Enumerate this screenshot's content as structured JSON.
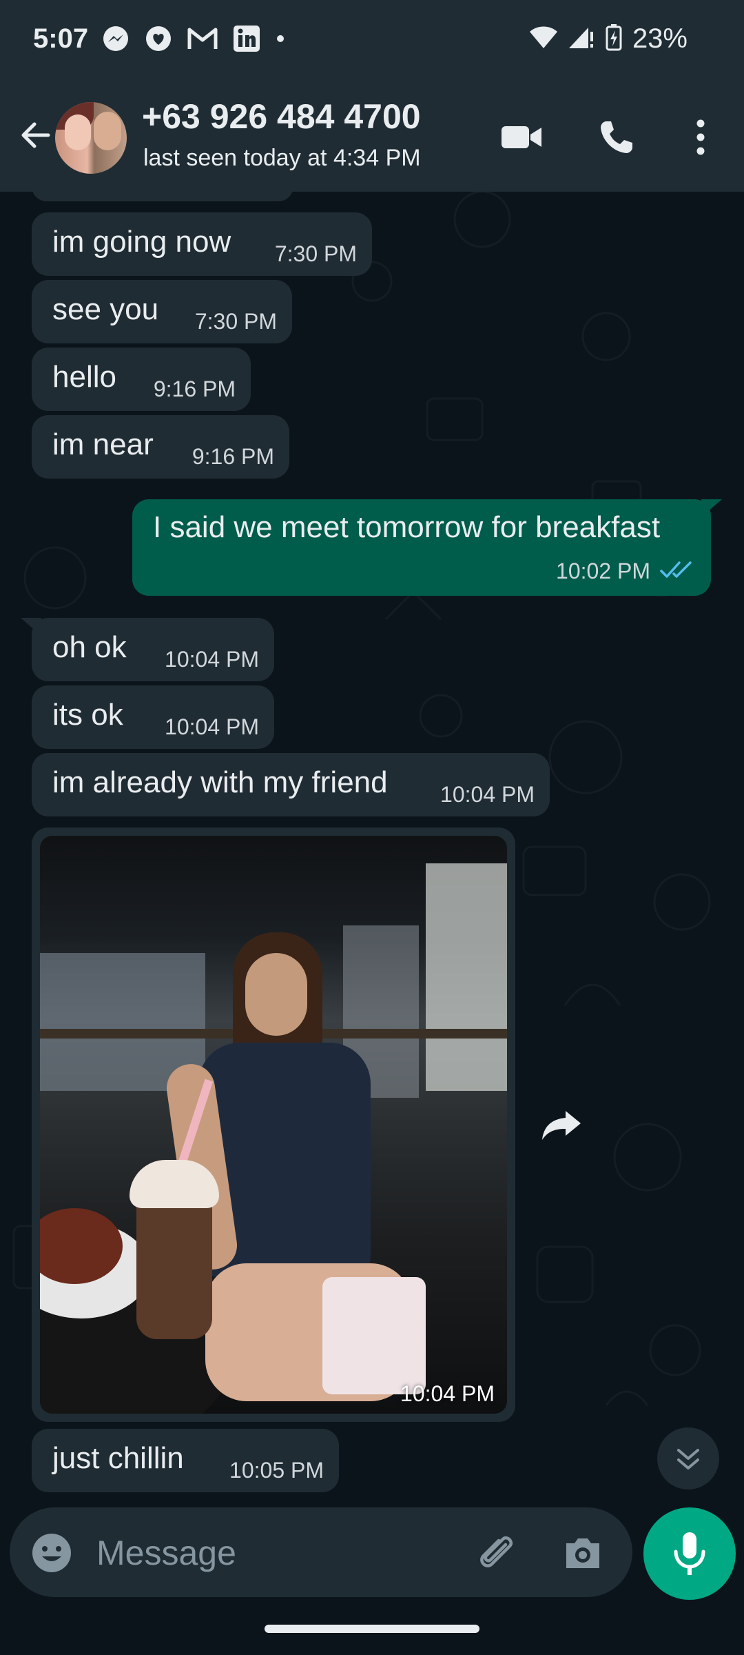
{
  "status_bar": {
    "time": "5:07",
    "battery": "23%",
    "notification_icons": [
      "messenger-icon",
      "heart-chat-icon",
      "gmail-icon",
      "linkedin-icon",
      "dot-icon"
    ]
  },
  "header": {
    "contact_name": "+63 926 484 4700",
    "last_seen": "last seen today at 4:34 PM"
  },
  "messages": [
    {
      "direction": "in",
      "text": "im going now",
      "time": "7:30 PM"
    },
    {
      "direction": "in",
      "text": "see you",
      "time": "7:30 PM"
    },
    {
      "direction": "in",
      "text": "hello",
      "time": "9:16 PM"
    },
    {
      "direction": "in",
      "text": "im near",
      "time": "9:16 PM"
    },
    {
      "direction": "out",
      "text": "I said we meet tomorrow for breakfast",
      "time": "10:02 PM",
      "read": true
    },
    {
      "direction": "in",
      "text": "oh ok",
      "time": "10:04 PM"
    },
    {
      "direction": "in",
      "text": "its ok",
      "time": "10:04 PM"
    },
    {
      "direction": "in",
      "text": "im already with my friend",
      "time": "10:04 PM"
    },
    {
      "direction": "in",
      "type": "photo",
      "time": "10:04 PM"
    },
    {
      "direction": "in",
      "text": "just chillin",
      "time": "10:05 PM"
    }
  ],
  "input": {
    "placeholder": "Message"
  },
  "colors": {
    "header_bg": "#1f2c34",
    "chat_bg": "#0b141a",
    "incoming_bubble": "#202c33",
    "outgoing_bubble": "#005c4b",
    "accent": "#00a884",
    "read_ticks": "#53bdeb"
  }
}
